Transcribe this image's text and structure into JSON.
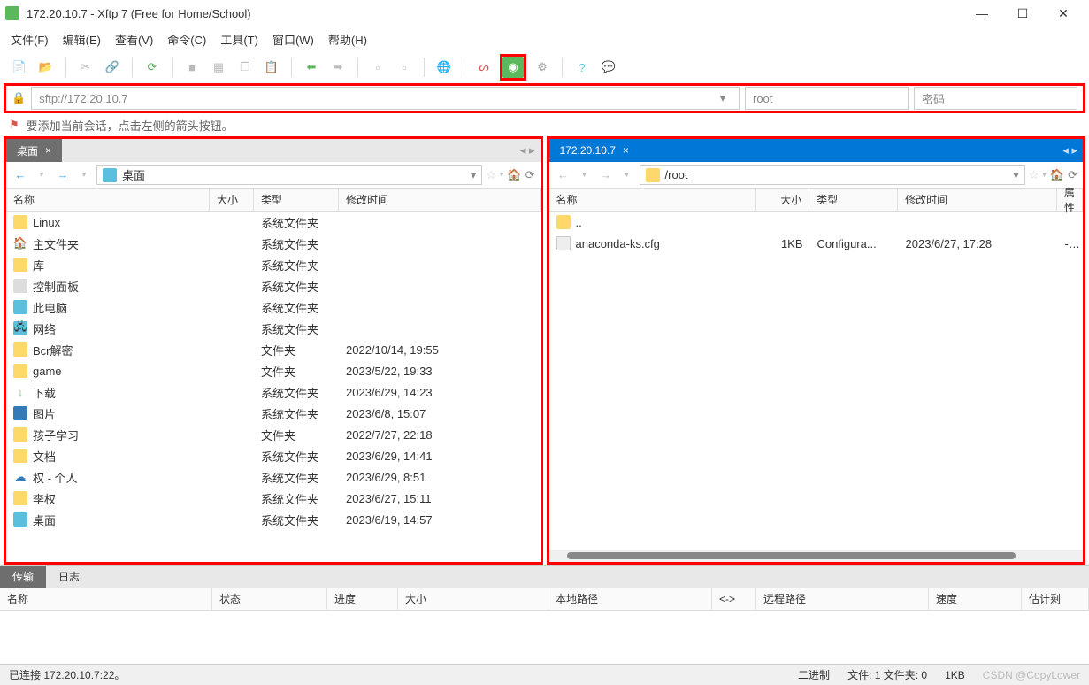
{
  "window": {
    "title": "172.20.10.7 - Xftp 7 (Free for Home/School)"
  },
  "menu": {
    "file": "文件(F)",
    "edit": "编辑(E)",
    "view": "查看(V)",
    "command": "命令(C)",
    "tools": "工具(T)",
    "window": "窗口(W)",
    "help": "帮助(H)"
  },
  "address": {
    "url": "sftp://172.20.10.7",
    "user": "root",
    "pass_placeholder": "密码"
  },
  "hint": "要添加当前会话，点击左侧的箭头按钮。",
  "local": {
    "tab": "桌面",
    "path": "桌面",
    "cols": {
      "name": "名称",
      "size": "大小",
      "type": "类型",
      "date": "修改时间"
    },
    "rows": [
      {
        "icon": "folder",
        "name": "Linux",
        "size": "",
        "type": "系统文件夹",
        "date": ""
      },
      {
        "icon": "home",
        "name": "主文件夹",
        "size": "",
        "type": "系统文件夹",
        "date": ""
      },
      {
        "icon": "folder",
        "name": "库",
        "size": "",
        "type": "系统文件夹",
        "date": ""
      },
      {
        "icon": "sys",
        "name": "控制面板",
        "size": "",
        "type": "系统文件夹",
        "date": ""
      },
      {
        "icon": "pc",
        "name": "此电脑",
        "size": "",
        "type": "系统文件夹",
        "date": ""
      },
      {
        "icon": "net",
        "name": "网络",
        "size": "",
        "type": "系统文件夹",
        "date": ""
      },
      {
        "icon": "folder",
        "name": "Bcr解密",
        "size": "",
        "type": "文件夹",
        "date": "2022/10/14, 19:55"
      },
      {
        "icon": "folder",
        "name": "game",
        "size": "",
        "type": "文件夹",
        "date": "2023/5/22, 19:33"
      },
      {
        "icon": "dl",
        "name": "下载",
        "size": "",
        "type": "系统文件夹",
        "date": "2023/6/29, 14:23"
      },
      {
        "icon": "pic",
        "name": "图片",
        "size": "",
        "type": "系统文件夹",
        "date": "2023/6/8, 15:07"
      },
      {
        "icon": "folder",
        "name": "孩子学习",
        "size": "",
        "type": "文件夹",
        "date": "2022/7/27, 22:18"
      },
      {
        "icon": "folder",
        "name": "文档",
        "size": "",
        "type": "系统文件夹",
        "date": "2023/6/29, 14:41"
      },
      {
        "icon": "cloud",
        "name": "权 - 个人",
        "size": "",
        "type": "系统文件夹",
        "date": "2023/6/29, 8:51"
      },
      {
        "icon": "folder",
        "name": "李权",
        "size": "",
        "type": "系统文件夹",
        "date": "2023/6/27, 15:11"
      },
      {
        "icon": "pc",
        "name": "桌面",
        "size": "",
        "type": "系统文件夹",
        "date": "2023/6/19, 14:57"
      }
    ]
  },
  "remote": {
    "tab": "172.20.10.7",
    "path": "/root",
    "cols": {
      "name": "名称",
      "size": "大小",
      "type": "类型",
      "date": "修改时间",
      "attr": "属性"
    },
    "rows": [
      {
        "icon": "folder-open",
        "name": "..",
        "size": "",
        "type": "",
        "date": "",
        "attr": ""
      },
      {
        "icon": "file",
        "name": "anaconda-ks.cfg",
        "size": "1KB",
        "type": "Configura...",
        "date": "2023/6/27, 17:28",
        "attr": "-rw---"
      }
    ]
  },
  "bottom": {
    "tab_transfer": "传输",
    "tab_log": "日志",
    "cols": {
      "name": "名称",
      "status": "状态",
      "progress": "进度",
      "size": "大小",
      "local": "本地路径",
      "arrow": "<->",
      "remote": "远程路径",
      "speed": "速度",
      "eta": "估计剩"
    }
  },
  "status": {
    "conn": "已连接 172.20.10.7:22。",
    "binary": "二进制",
    "files": "文件: 1 文件夹: 0",
    "size": "1KB",
    "watermark": "CSDN @CopyLower"
  }
}
